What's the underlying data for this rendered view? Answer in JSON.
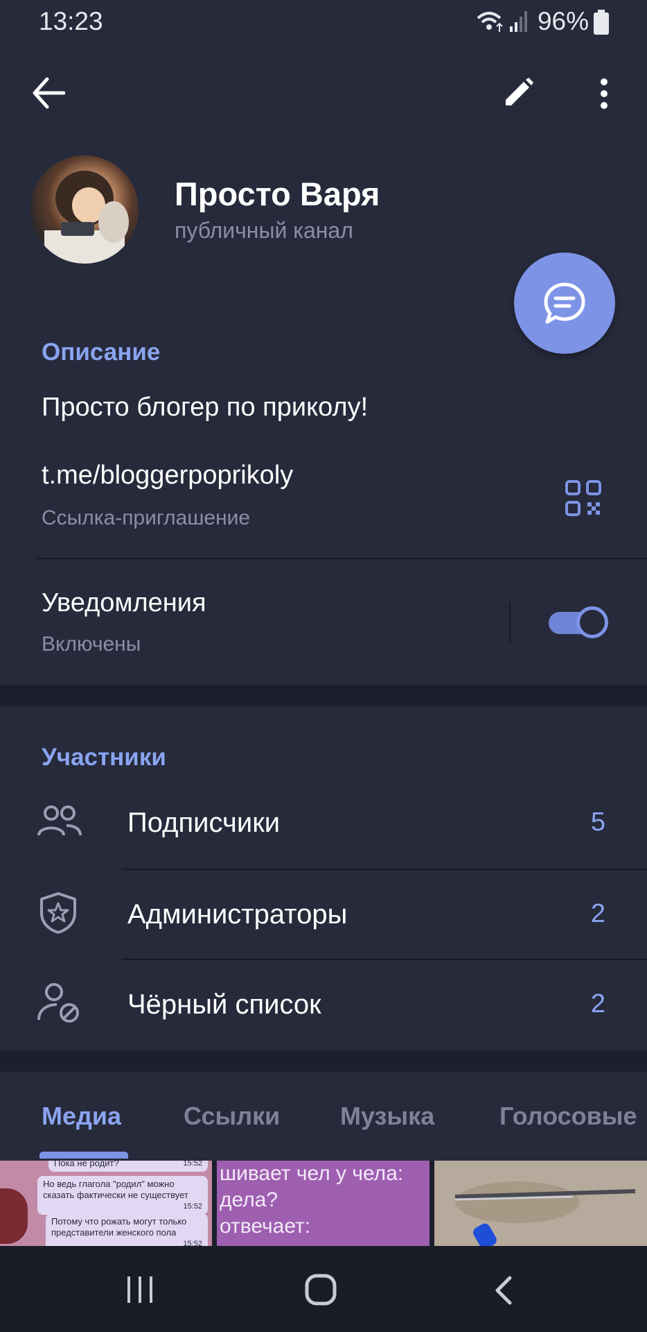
{
  "status_bar": {
    "time": "13:23",
    "battery": "96%"
  },
  "channel": {
    "name": "Просто Варя",
    "type": "публичный канал"
  },
  "info": {
    "section_title": "Описание",
    "description": "Просто блогер по приколу!",
    "link": "t.me/bloggerpoprikoly",
    "link_caption": "Ссылка-приглашение",
    "notifications_label": "Уведомления",
    "notifications_state": "Включены",
    "notifications_enabled": true
  },
  "members": {
    "section_title": "Участники",
    "rows": [
      {
        "label": "Подписчики",
        "count": "5",
        "icon": "users-icon"
      },
      {
        "label": "Администраторы",
        "count": "2",
        "icon": "shield-star-icon"
      },
      {
        "label": "Чёрный список",
        "count": "2",
        "icon": "user-blocked-icon"
      }
    ]
  },
  "tabs": {
    "items": [
      "Медиа",
      "Ссылки",
      "Музыка",
      "Голосовые"
    ],
    "active": "Медиа"
  },
  "media": {
    "thumb1": {
      "lines": [
        "Пока не родит?",
        "Но ведь глагола \"родил\" можно сказать фактически не существует",
        "Потому что рожать могут только представители женского пола"
      ],
      "times": [
        "15:52",
        "15:52",
        "15:52"
      ]
    },
    "thumb2": {
      "text": [
        "шивает чел у чела:",
        "дела?",
        "отвечает:"
      ]
    }
  },
  "colors": {
    "accent": "#7d93e6",
    "background": "#1c1f2e",
    "card": "#262a3b"
  }
}
